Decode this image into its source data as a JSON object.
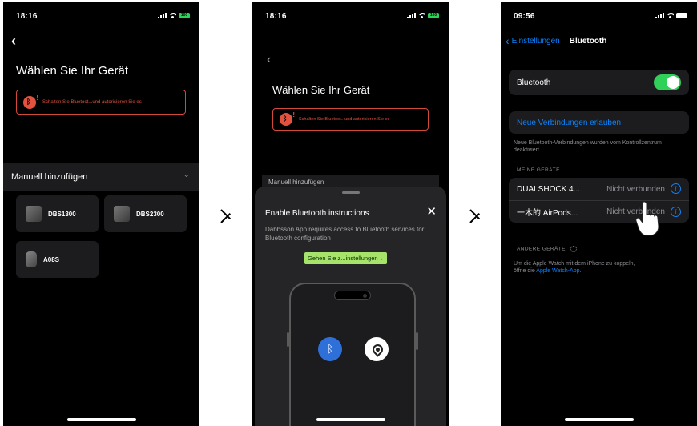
{
  "panel1": {
    "time": "18:16",
    "battery": "100",
    "title": "Wählen Sie Ihr Gerät",
    "warning": "Schalten Sie Bluetoot...und autorisieren Sie es",
    "section": "Manuell hinzufügen",
    "devices": [
      "DBS1300",
      "DBS2300",
      "A08S"
    ]
  },
  "panel2": {
    "time": "18:16",
    "battery": "100",
    "title": "Wählen Sie Ihr Gerät",
    "warning": "Schalten Sie Bluetoot...und autorisieren Sie es",
    "behind_section": "Manuell hinzufügen",
    "sheet": {
      "title": "Enable Bluetooth instructions",
      "close": "✕",
      "desc": "Dabbsson App requires access to Bluetooth services for Bluetooth configuration",
      "button": "Gehen Sie z...instellungen→"
    }
  },
  "panel3": {
    "time": "09:56",
    "nav": {
      "back": "Einstellungen",
      "title": "Bluetooth"
    },
    "bluetooth_label": "Bluetooth",
    "allow_new": "Neue Verbindungen erlauben",
    "allow_note": "Neue Bluetooth-Verbindungen wurden vom Kontrollzentrum deaktiviert.",
    "my_devices_caption": "MEINE GERÄTE",
    "my_devices": [
      {
        "name": "DUALSHOCK 4...",
        "status": "Nicht verbunden"
      },
      {
        "name": "一木的 AirPods...",
        "status": "Nicht verbunden"
      }
    ],
    "other_caption": "ANDERE GERÄTE",
    "watch_note_1": "Um die Apple Watch mit dem iPhone zu koppeln,",
    "watch_note_2": "öffne die",
    "watch_link": "Apple Watch-App",
    "watch_note_3": "."
  }
}
